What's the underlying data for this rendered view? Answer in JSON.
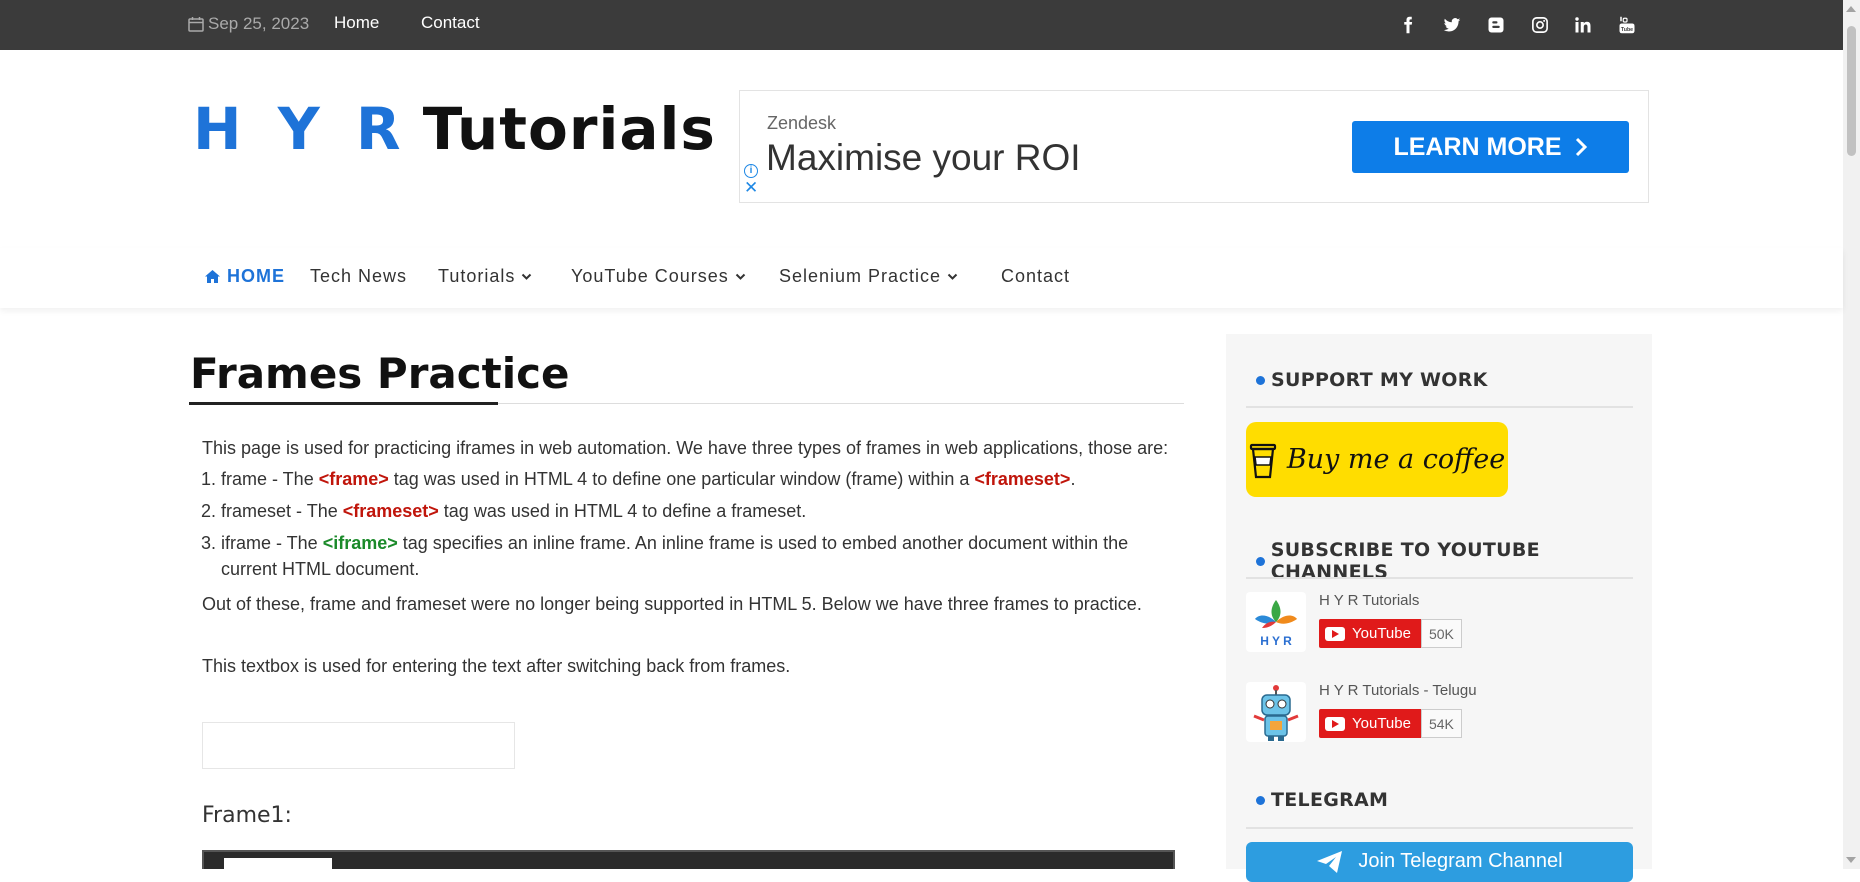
{
  "topbar": {
    "date": "Sep 25, 2023",
    "links": [
      "Home",
      "Contact"
    ],
    "social_icons": [
      "facebook-icon",
      "twitter-icon",
      "blogger-icon",
      "instagram-icon",
      "linkedin-icon",
      "youtube-icon"
    ]
  },
  "logo": {
    "part1": "H Y R",
    "part2": "Tutorials"
  },
  "ad": {
    "brand": "Zendesk",
    "headline": "Maximise your ROI",
    "cta": "LEARN MORE"
  },
  "nav": {
    "home": "HOME",
    "items": [
      "Tech News",
      "Tutorials",
      "YouTube Courses",
      "Selenium Practice",
      "Contact"
    ]
  },
  "main": {
    "title": "Frames Practice",
    "intro": "This page is used for practicing iframes in web automation. We have three types of frames in web applications, those are:",
    "list": [
      {
        "pre": "frame - The ",
        "tag": "<frame>",
        "mid": " tag was used in HTML 4 to define one particular window (frame) within a ",
        "tag2": "<frameset>",
        "post": "."
      },
      {
        "pre": "frameset - The ",
        "tag": "<frameset>",
        "post": " tag was used in HTML 4 to define a frameset."
      },
      {
        "pre": "iframe - The ",
        "tag": "<iframe>",
        "post": " tag specifies an inline frame. An inline frame is used to embed another document within the current HTML document."
      }
    ],
    "outro": "Out of these, frame and frameset were no longer being supported in HTML 5. Below we have three frames to practice.",
    "textbox_label": "This textbox is used for entering the text after switching back from frames.",
    "textbox_value": "",
    "frame1_label": "Frame1:"
  },
  "sidebar": {
    "support_title": "SUPPORT MY WORK",
    "coffee_label": "Buy me a coffee",
    "subscribe_title": "SUBSCRIBE TO YOUTUBE CHANNELS",
    "channels": [
      {
        "name": "H Y R Tutorials",
        "button": "YouTube",
        "count": "50K"
      },
      {
        "name": "H Y R Tutorials - Telugu",
        "button": "YouTube",
        "count": "54K"
      }
    ],
    "telegram_title": "TELEGRAM",
    "telegram_button": "Join Telegram Channel"
  }
}
